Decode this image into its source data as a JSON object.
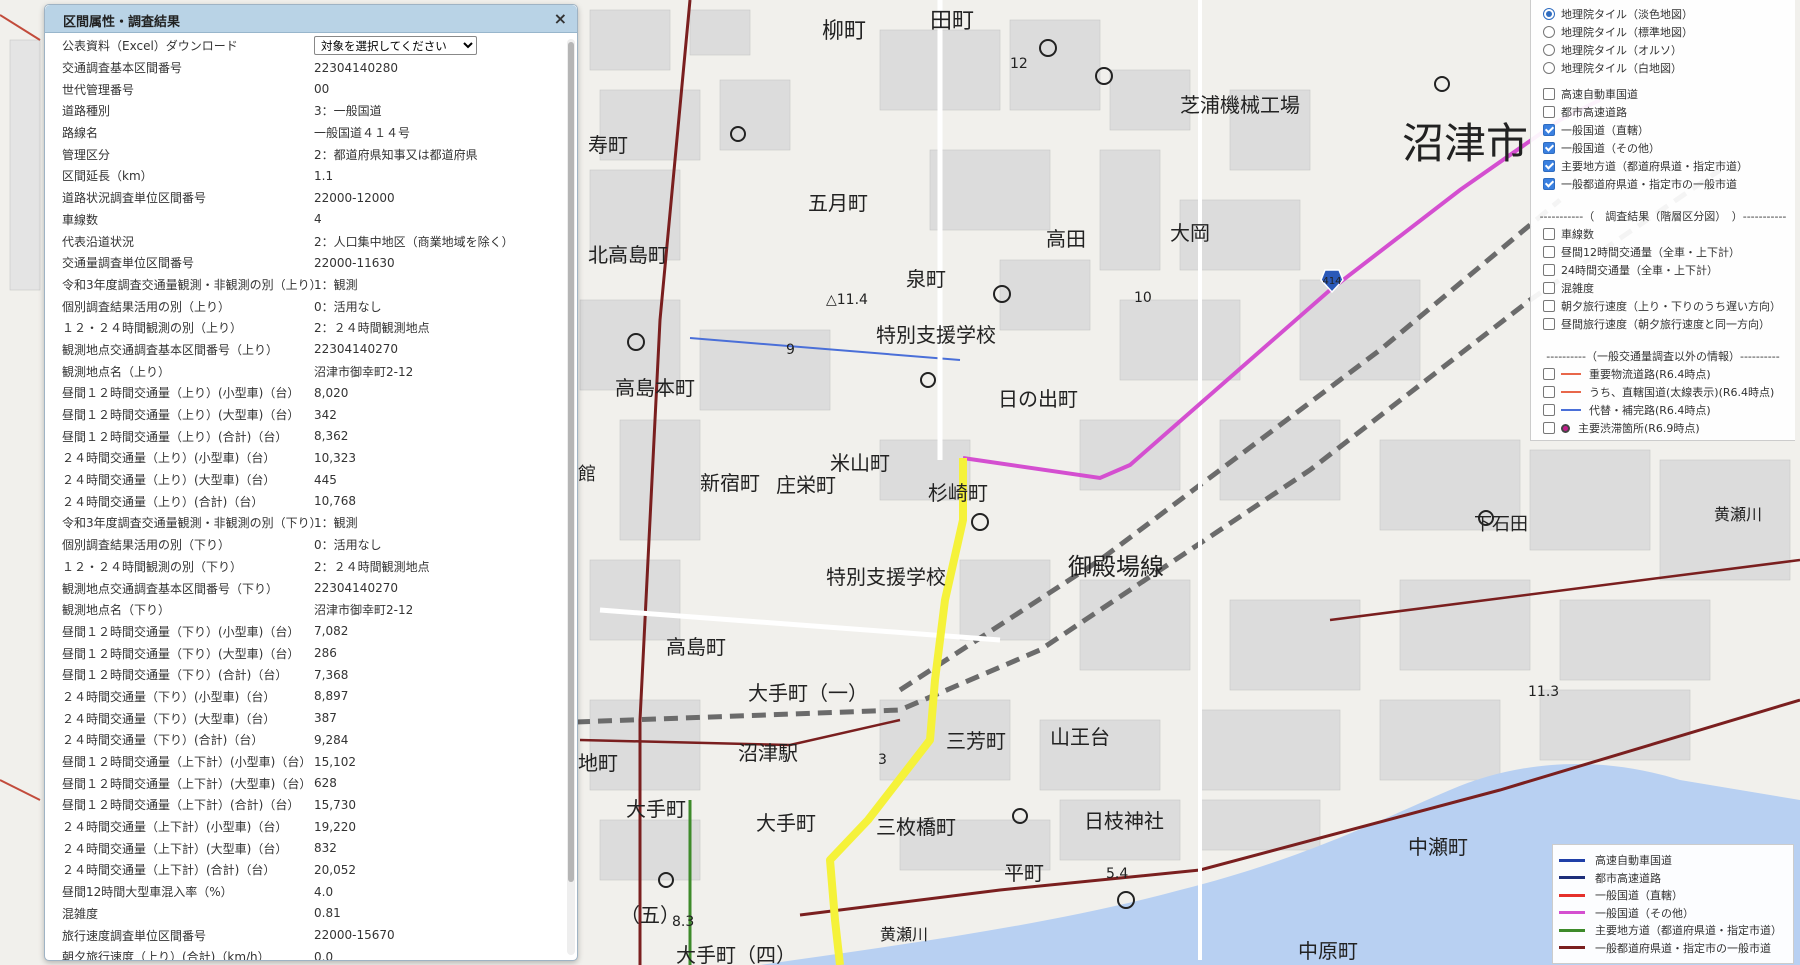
{
  "map_labels": {
    "yanagicho": "柳町",
    "tadamachi": "田町",
    "kotobukicho": "寿町",
    "gogatsucho": "五月町",
    "kitatakashimacho": "北高島町",
    "izumicho": "泉町",
    "tokubetsu_school": "特別支援学校",
    "hinodecho": "日の出町",
    "takashimahoncho": "高島本町",
    "shinjukucho": "新宿町",
    "shoeicho": "庄栄町",
    "yoneyamacho": "米山町",
    "sugisakicho": "杉崎町",
    "tokubetsu_school2": "特別支援学校",
    "takashimacho": "高島町",
    "otemachi1": "大手町（一）",
    "shibaura_kikai": "芝浦機械工場",
    "takada": "高田",
    "ooka": "大岡",
    "numazu_city": "沼津市",
    "gotemba_line": "御殿場線",
    "sanpocho": "三芳町",
    "sannodai": "山王台",
    "hiedajinja": "日枝神社",
    "sanmaibashicho": "三枚橋町",
    "hiramachi": "平町",
    "nakasecho": "中瀬町",
    "nakaharacho": "中原町",
    "numazu_eki": "沼津駅",
    "otemachi": "大手町",
    "otemachi_left": "大手町",
    "otemachi5": "（五）",
    "otemachi4": "大手町（四）",
    "jichimachi": "地町",
    "kan": "館",
    "shimoishida": "下石田",
    "kiseagawa": "黄瀬川",
    "kisegawa2": "黄瀬川",
    "elev1": "12",
    "elev2": "△11.4",
    "elev3": "10",
    "elev4": "9",
    "elev5": "11.3",
    "elev6": "5.4",
    "elev7": "8.3",
    "elev8": "3",
    "route_shield": "414"
  },
  "attribute_panel": {
    "title": "区間属性・調査結果",
    "close_symbol": "×",
    "excel_label": "公表資料（Excel）ダウンロード",
    "excel_select_value": "対象を選択してください",
    "rows": [
      {
        "k": "交通調査基本区間番号",
        "v": "22304140280"
      },
      {
        "k": "世代管理番号",
        "v": "00"
      },
      {
        "k": "道路種別",
        "v": "3：一般国道"
      },
      {
        "k": "路線名",
        "v": "一般国道４１４号"
      },
      {
        "k": "管理区分",
        "v": "2：都道府県知事又は都道府県"
      },
      {
        "k": "区間延長（km）",
        "v": "1.1"
      },
      {
        "k": "道路状況調査単位区間番号",
        "v": "22000-12000"
      },
      {
        "k": "車線数",
        "v": "4"
      },
      {
        "k": "代表沿道状況",
        "v": "2：人口集中地区（商業地域を除く）"
      },
      {
        "k": "交通量調査単位区間番号",
        "v": "22000-11630"
      },
      {
        "k": "令和3年度調査交通量観測・非観測の別（上り）",
        "v": "1：観測"
      },
      {
        "k": "個別調査結果活用の別（上り）",
        "v": "0：活用なし"
      },
      {
        "k": "１２・２４時間観測の別（上り）",
        "v": "2：２４時間観測地点"
      },
      {
        "k": "観測地点交通調査基本区間番号（上り）",
        "v": "22304140270"
      },
      {
        "k": "観測地点名（上り）",
        "v": "沼津市御幸町2-12"
      },
      {
        "k": "昼間１２時間交通量（上り）(小型車)（台）",
        "v": "8,020"
      },
      {
        "k": "昼間１２時間交通量（上り）(大型車)（台）",
        "v": "342"
      },
      {
        "k": "昼間１２時間交通量（上り）(合計)（台）",
        "v": "8,362"
      },
      {
        "k": "２４時間交通量（上り）(小型車)（台）",
        "v": "10,323"
      },
      {
        "k": "２４時間交通量（上り）(大型車)（台）",
        "v": "445"
      },
      {
        "k": "２４時間交通量（上り）(合計)（台）",
        "v": "10,768"
      },
      {
        "k": "令和3年度調査交通量観測・非観測の別（下り）",
        "v": "1：観測"
      },
      {
        "k": "個別調査結果活用の別（下り）",
        "v": "0：活用なし"
      },
      {
        "k": "１２・２４時間観測の別（下り）",
        "v": "2：２４時間観測地点"
      },
      {
        "k": "観測地点交通調査基本区間番号（下り）",
        "v": "22304140270"
      },
      {
        "k": "観測地点名（下り）",
        "v": "沼津市御幸町2-12"
      },
      {
        "k": "昼間１２時間交通量（下り）(小型車)（台）",
        "v": "7,082"
      },
      {
        "k": "昼間１２時間交通量（下り）(大型車)（台）",
        "v": "286"
      },
      {
        "k": "昼間１２時間交通量（下り）(合計)（台）",
        "v": "7,368"
      },
      {
        "k": "２４時間交通量（下り）(小型車)（台）",
        "v": "8,897"
      },
      {
        "k": "２４時間交通量（下り）(大型車)（台）",
        "v": "387"
      },
      {
        "k": "２４時間交通量（下り）(合計)（台）",
        "v": "9,284"
      },
      {
        "k": "昼間１２時間交通量（上下計）(小型車)（台）",
        "v": "15,102"
      },
      {
        "k": "昼間１２時間交通量（上下計）(大型車)（台）",
        "v": "628"
      },
      {
        "k": "昼間１２時間交通量（上下計）(合計)（台）",
        "v": "15,730"
      },
      {
        "k": "２４時間交通量（上下計）(小型車)（台）",
        "v": "19,220"
      },
      {
        "k": "２４時間交通量（上下計）(大型車)（台）",
        "v": "832"
      },
      {
        "k": "２４時間交通量（上下計）(合計)（台）",
        "v": "20,052"
      },
      {
        "k": "昼間12時間大型車混入率（%）",
        "v": "4.0"
      },
      {
        "k": "混雑度",
        "v": "0.81"
      },
      {
        "k": "旅行速度調査単位区間番号",
        "v": "22000-15670"
      },
      {
        "k": "朝夕旅行速度（上り）(合計)（km/h）",
        "v": "0.0"
      }
    ]
  },
  "layer_panel": {
    "tiles": [
      {
        "label": "地理院タイル（淡色地図）",
        "on": true
      },
      {
        "label": "地理院タイル（標準地図）",
        "on": false
      },
      {
        "label": "地理院タイル（オルソ）",
        "on": false
      },
      {
        "label": "地理院タイル（白地図）",
        "on": false
      }
    ],
    "roads": [
      {
        "label": "高速自動車国道",
        "on": false
      },
      {
        "label": "都市高速道路",
        "on": false
      },
      {
        "label": "一般国道（直轄）",
        "on": true
      },
      {
        "label": "一般国道（その他）",
        "on": true
      },
      {
        "label": "主要地方道（都道府県道・指定市道）",
        "on": true
      },
      {
        "label": "一般都道府県道・指定市の一般市道",
        "on": true
      }
    ],
    "survey_header": "-----------（　調査結果（階層区分図）　）-----------",
    "survey": [
      {
        "label": "車線数",
        "on": false
      },
      {
        "label": "昼間12時間交通量（全車・上下計）",
        "on": false
      },
      {
        "label": "24時間交通量（全車・上下計）",
        "on": false
      },
      {
        "label": "混雑度",
        "on": false
      },
      {
        "label": "朝夕旅行速度（上り・下りのうち遅い方向）",
        "on": false
      },
      {
        "label": "昼間旅行速度（朝夕旅行速度と同一方向）",
        "on": false
      }
    ],
    "other_header": "----------（一般交通量調査以外の情報）----------",
    "other": [
      {
        "label": "重要物流道路(R6.4時点)",
        "on": false,
        "color": "#e8674a"
      },
      {
        "label": "うち、直轄国道(太線表示)(R6.4時点)",
        "on": false,
        "color": "#e8674a"
      },
      {
        "label": "代替・補完路(R6.4時点)",
        "on": false,
        "color": "#4a6fd8"
      },
      {
        "label": "主要渋滞箇所(R6.9時点)",
        "on": false,
        "color": "#c21d8a"
      }
    ]
  },
  "legend": {
    "items": [
      {
        "label": "高速自動車国道",
        "color": "#1f3fa8"
      },
      {
        "label": "都市高速道路",
        "color": "#1d2e7a"
      },
      {
        "label": "一般国道（直轄）",
        "color": "#e5302b"
      },
      {
        "label": "一般国道（その他）",
        "color": "#d44fd0"
      },
      {
        "label": "主要地方道（都道府県道・指定市道）",
        "color": "#3d8a2a"
      },
      {
        "label": "一般都道府県道・指定市の一般市道",
        "color": "#7a1f1f"
      }
    ]
  }
}
